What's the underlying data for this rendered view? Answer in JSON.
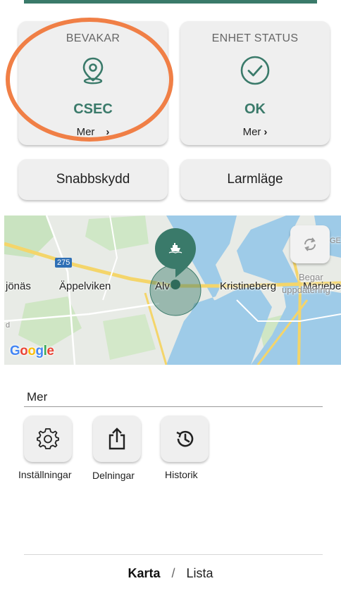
{
  "status_cards": {
    "guarding": {
      "title": "BEVAKAR",
      "value": "CSEC",
      "more": "Mer",
      "icon": "location-pin-icon"
    },
    "device_status": {
      "title": "ENHET STATUS",
      "value": "OK",
      "more": "Mer",
      "icon": "check-circle-icon"
    }
  },
  "quick_buttons": {
    "quick_protect": "Snabbskydd",
    "alarm_mode": "Larmläge"
  },
  "map": {
    "labels": {
      "jonas": "jönäs",
      "appelviken": "Äppelviken",
      "alvik": "Alv",
      "kristineberg": "Kristineberg",
      "marieberg": "Mariebe",
      "begar": "Begar",
      "uppdatering": "uppdatering",
      "road_275": "275",
      "edge_d": "d",
      "edge_ge": "GE"
    },
    "google_logo": "Google",
    "marker_icon": "boat-icon",
    "refresh_icon": "refresh-icon"
  },
  "more_section": {
    "label": "Mer",
    "actions": [
      {
        "label": "Inställningar",
        "icon": "gear-icon"
      },
      {
        "label": "Delningar",
        "icon": "share-icon"
      },
      {
        "label": "Historik",
        "icon": "history-icon"
      }
    ]
  },
  "bottom_nav": {
    "map": "Karta",
    "separator": "/",
    "list": "Lista"
  },
  "colors": {
    "accent": "#3a7a6a",
    "highlight": "#f07f46",
    "card_bg": "#efefef",
    "water": "#9ecbe8"
  }
}
